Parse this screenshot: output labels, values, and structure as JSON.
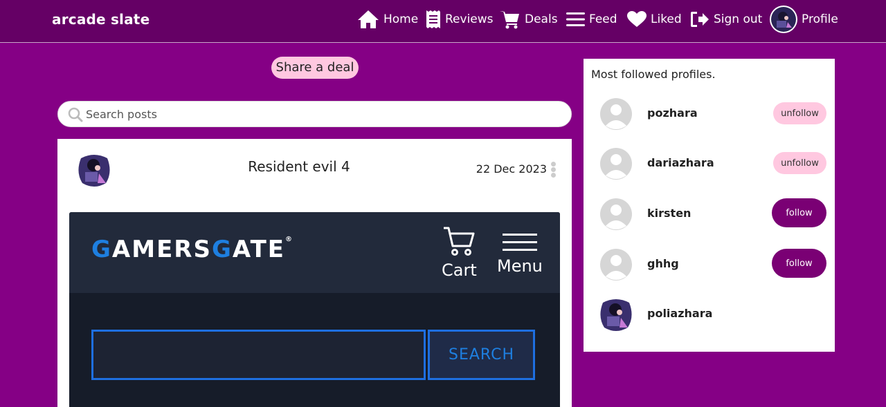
{
  "app": {
    "brand": "arcade slate"
  },
  "nav": {
    "home": "Home",
    "reviews": "Reviews",
    "deals": "Deals",
    "feed": "Feed",
    "liked": "Liked",
    "sign_out": "Sign out",
    "profile": "Profile"
  },
  "main": {
    "share_label": "Share a deal",
    "search_placeholder": "Search posts"
  },
  "post": {
    "title": "Resident evil 4",
    "date": "22 Dec 2023",
    "image": {
      "logo_pre": "G",
      "logo_mid": "AMERS",
      "logo_g2": "G",
      "logo_post": "ATE",
      "logo_mark": "®",
      "cart_label": "Cart",
      "menu_label": "Menu",
      "search_label": "SEARCH"
    }
  },
  "sidebar": {
    "title": "Most followed profiles.",
    "profiles": [
      {
        "name": "pozhara",
        "action": "unfollow"
      },
      {
        "name": "dariazhara",
        "action": "unfollow"
      },
      {
        "name": "kirsten",
        "action": "follow"
      },
      {
        "name": "ghhg",
        "action": "follow"
      },
      {
        "name": "poliazhara",
        "action": ""
      }
    ]
  },
  "colors": {
    "background": "#850085",
    "navbar": "#650065",
    "pink_button": "#ffc8e0",
    "follow_button": "#7a0074",
    "gamersgate_blue": "#1e7fe0"
  }
}
